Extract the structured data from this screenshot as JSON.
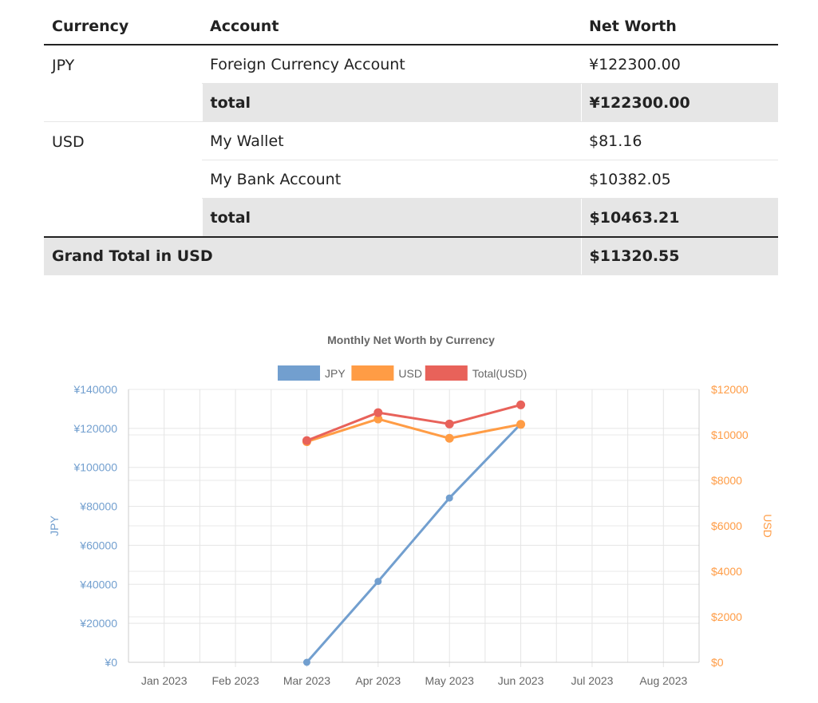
{
  "table": {
    "headers": {
      "currency": "Currency",
      "account": "Account",
      "net_worth": "Net Worth"
    },
    "groups": [
      {
        "currency": "JPY",
        "rows": [
          {
            "account": "Foreign Currency Account",
            "net_worth": "¥122300.00"
          }
        ],
        "total_label": "total",
        "total_value": "¥122300.00"
      },
      {
        "currency": "USD",
        "rows": [
          {
            "account": "My Wallet",
            "net_worth": "$81.16"
          },
          {
            "account": "My Bank Account",
            "net_worth": "$10382.05"
          }
        ],
        "total_label": "total",
        "total_value": "$10463.21"
      }
    ],
    "grand_total_label": "Grand Total in USD",
    "grand_total_value": "$11320.55"
  },
  "chart_data": {
    "type": "line",
    "title": "Monthly Net Worth by Currency",
    "categories": [
      "Jan 2023",
      "Feb 2023",
      "Mar 2023",
      "Apr 2023",
      "May 2023",
      "Jun 2023",
      "Jul 2023",
      "Aug 2023"
    ],
    "y_left": {
      "label": "JPY",
      "range": [
        0,
        140000
      ],
      "ticks": [
        "¥0",
        "¥20000",
        "¥40000",
        "¥60000",
        "¥80000",
        "¥100000",
        "¥120000",
        "¥140000"
      ]
    },
    "y_right": {
      "label": "USD",
      "range": [
        0,
        12000
      ],
      "ticks": [
        "$0",
        "$2000",
        "$4000",
        "$6000",
        "$8000",
        "$10000",
        "$12000"
      ]
    },
    "grid": true,
    "legend_position": "top",
    "series": [
      {
        "name": "JPY",
        "axis": "left",
        "color": "#729fcf",
        "values": [
          null,
          null,
          0,
          41500,
          84300,
          122300,
          null,
          null
        ]
      },
      {
        "name": "USD",
        "axis": "right",
        "color": "#ff9c45",
        "values": [
          null,
          null,
          9700,
          10700,
          9850,
          10463.21,
          null,
          null
        ]
      },
      {
        "name": "Total(USD)",
        "axis": "right",
        "color": "#e8625a",
        "values": [
          null,
          null,
          9750,
          10980,
          10480,
          11320.55,
          null,
          null
        ]
      }
    ],
    "axis_colors": {
      "left": "#729fcf",
      "right": "#ff9c45"
    }
  }
}
